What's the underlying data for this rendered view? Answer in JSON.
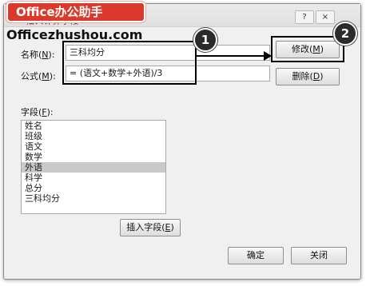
{
  "header": {
    "logo_text": "Office办公助手",
    "site_text": "Officezhushou.com",
    "dialog_title": "插入计算字段",
    "help_button": "?",
    "close_button": "×"
  },
  "form": {
    "name_label_prefix": "名称(",
    "name_label_key": "N",
    "name_label_suffix": "):",
    "name_value": "三科均分",
    "formula_label_prefix": "公式(",
    "formula_label_key": "M",
    "formula_label_suffix": "):",
    "formula_value": "= (语文+数学+外语)/3"
  },
  "buttons": {
    "modify_prefix": "修改(",
    "modify_key": "M",
    "modify_suffix": ")",
    "delete_prefix": "删除(",
    "delete_key": "D",
    "delete_suffix": ")",
    "insert_field_prefix": "插入字段(",
    "insert_field_key": "E",
    "insert_field_suffix": ")",
    "ok": "确定",
    "close": "关闭"
  },
  "fields": {
    "label_prefix": "字段(",
    "label_key": "F",
    "label_suffix": "):",
    "items": [
      "姓名",
      "班级",
      "语文",
      "数学",
      "外语",
      "科学",
      "总分",
      "三科均分"
    ],
    "selected": "外语"
  },
  "callouts": {
    "one": "1",
    "two": "2"
  }
}
